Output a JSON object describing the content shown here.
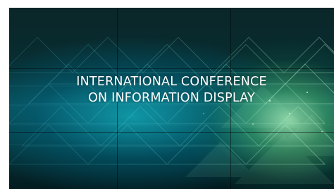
{
  "screen": {
    "title_line_1": "INTERNATIONAL CONFERENCE",
    "title_line_2": "ON INFORMATION DISPLAY"
  },
  "style": {
    "text_color": "#ffffff",
    "page_background": "#ffffff",
    "wall_dark": "#072d31",
    "wall_teal": "#0a4b53",
    "wall_green": "#9ff0a8"
  }
}
